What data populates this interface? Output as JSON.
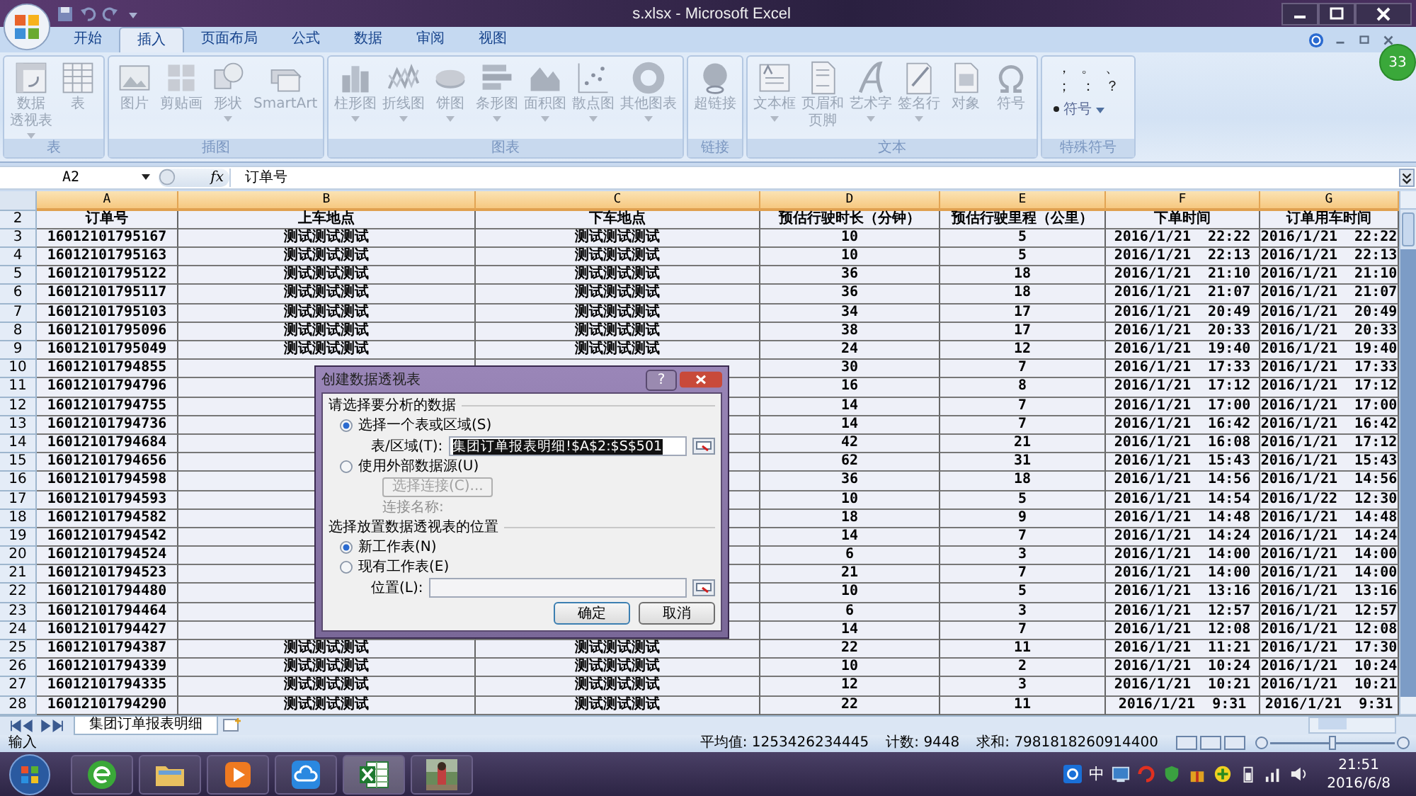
{
  "window": {
    "title": "s.xlsx - Microsoft Excel"
  },
  "ribbon_tabs": [
    {
      "label": "开始",
      "selected": false
    },
    {
      "label": "插入",
      "selected": true
    },
    {
      "label": "页面布局",
      "selected": false
    },
    {
      "label": "公式",
      "selected": false
    },
    {
      "label": "数据",
      "selected": false
    },
    {
      "label": "审阅",
      "selected": false
    },
    {
      "label": "视图",
      "selected": false
    }
  ],
  "badge": "33",
  "ribbon_groups": [
    {
      "label": "表",
      "kind": "buttons",
      "buttons": [
        {
          "lines": [
            "数据",
            "透视表"
          ],
          "dropdown": true
        },
        {
          "label": "表",
          "dropdown": false
        }
      ]
    },
    {
      "label": "插图",
      "kind": "buttons",
      "buttons": [
        {
          "label": "图片",
          "dropdown": false
        },
        {
          "label": "剪贴画",
          "dropdown": false
        },
        {
          "label": "形状",
          "dropdown": true
        },
        {
          "label": "SmartArt",
          "dropdown": false
        }
      ]
    },
    {
      "label": "图表",
      "kind": "buttons",
      "buttons": [
        {
          "label": "柱形图",
          "dropdown": true
        },
        {
          "label": "折线图",
          "dropdown": true
        },
        {
          "label": "饼图",
          "dropdown": true
        },
        {
          "label": "条形图",
          "dropdown": true
        },
        {
          "label": "面积图",
          "dropdown": true
        },
        {
          "label": "散点图",
          "dropdown": true
        },
        {
          "label": "其他图表",
          "dropdown": true
        }
      ]
    },
    {
      "label": "链接",
      "kind": "buttons",
      "buttons": [
        {
          "label": "超链接",
          "dropdown": false
        }
      ]
    },
    {
      "label": "文本",
      "kind": "buttons",
      "buttons": [
        {
          "label": "文本框",
          "dropdown": true
        },
        {
          "lines": [
            "页眉和",
            "页脚"
          ],
          "dropdown": false
        },
        {
          "label": "艺术字",
          "dropdown": true
        },
        {
          "label": "签名行",
          "dropdown": true
        },
        {
          "label": "对象",
          "dropdown": false
        },
        {
          "label": "符号",
          "dropdown": false
        }
      ]
    },
    {
      "label": "特殊符号",
      "kind": "symbols",
      "symbols": [
        "，",
        "。",
        "、",
        "；",
        "：",
        "？"
      ],
      "buttons": [
        {
          "label": "符号",
          "dropdown": true
        }
      ]
    }
  ],
  "formula_bar": {
    "name_box": "A2",
    "function_label": "fx",
    "content": "订单号"
  },
  "sheet": {
    "columns": [
      "A",
      "B",
      "C",
      "D",
      "E",
      "F",
      "G"
    ],
    "header_row": {
      "row": "2",
      "cells": [
        "订单号",
        "上车地点",
        "下车地点",
        "预估行驶时长（分钟）",
        "预估行驶里程（公里）",
        "下单时间",
        "订单用车时间"
      ]
    },
    "rows": [
      {
        "row": "3",
        "kind": "full",
        "cells": [
          "16012101795167",
          "测试测试测试",
          "测试测试测试",
          "10",
          "5",
          "2016/1/21  22:22",
          "2016/1/21  22:22"
        ]
      },
      {
        "row": "4",
        "kind": "full",
        "cells": [
          "16012101795163",
          "测试测试测试",
          "测试测试测试",
          "10",
          "5",
          "2016/1/21  22:13",
          "2016/1/21  22:13"
        ]
      },
      {
        "row": "5",
        "kind": "full",
        "cells": [
          "16012101795122",
          "测试测试测试",
          "测试测试测试",
          "36",
          "18",
          "2016/1/21  21:10",
          "2016/1/21  21:10"
        ]
      },
      {
        "row": "6",
        "kind": "full",
        "cells": [
          "16012101795117",
          "测试测试测试",
          "测试测试测试",
          "36",
          "18",
          "2016/1/21  21:07",
          "2016/1/21  21:07"
        ]
      },
      {
        "row": "7",
        "kind": "full",
        "cells": [
          "16012101795103",
          "测试测试测试",
          "测试测试测试",
          "34",
          "17",
          "2016/1/21  20:49",
          "2016/1/21  20:49"
        ]
      },
      {
        "row": "8",
        "kind": "full",
        "cells": [
          "16012101795096",
          "测试测试测试",
          "测试测试测试",
          "38",
          "17",
          "2016/1/21  20:33",
          "2016/1/21  20:33"
        ]
      },
      {
        "row": "9",
        "kind": "full",
        "cells": [
          "16012101795049",
          "测试测试测试",
          "测试测试测试",
          "24",
          "12",
          "2016/1/21  19:40",
          "2016/1/21  19:40"
        ]
      },
      {
        "row": "10",
        "kind": "covered",
        "cells": [
          "16012101794855",
          "30",
          "7",
          "2016/1/21  17:33",
          "2016/1/21  17:33"
        ]
      },
      {
        "row": "11",
        "kind": "covered",
        "cells": [
          "16012101794796",
          "16",
          "8",
          "2016/1/21  17:12",
          "2016/1/21  17:12"
        ]
      },
      {
        "row": "12",
        "kind": "covered",
        "cells": [
          "16012101794755",
          "14",
          "7",
          "2016/1/21  17:00",
          "2016/1/21  17:00"
        ]
      },
      {
        "row": "13",
        "kind": "covered",
        "cells": [
          "16012101794736",
          "14",
          "7",
          "2016/1/21  16:42",
          "2016/1/21  16:42"
        ]
      },
      {
        "row": "14",
        "kind": "covered",
        "cells": [
          "16012101794684",
          "42",
          "21",
          "2016/1/21  16:08",
          "2016/1/21  17:12"
        ]
      },
      {
        "row": "15",
        "kind": "covered",
        "cells": [
          "16012101794656",
          "62",
          "31",
          "2016/1/21  15:43",
          "2016/1/21  15:43"
        ]
      },
      {
        "row": "16",
        "kind": "covered",
        "cells": [
          "16012101794598",
          "36",
          "18",
          "2016/1/21  14:56",
          "2016/1/21  14:56"
        ]
      },
      {
        "row": "17",
        "kind": "covered",
        "cells": [
          "16012101794593",
          "10",
          "5",
          "2016/1/21  14:54",
          "2016/1/22  12:30"
        ]
      },
      {
        "row": "18",
        "kind": "covered",
        "cells": [
          "16012101794582",
          "18",
          "9",
          "2016/1/21  14:48",
          "2016/1/21  14:48"
        ]
      },
      {
        "row": "19",
        "kind": "covered",
        "cells": [
          "16012101794542",
          "14",
          "7",
          "2016/1/21  14:24",
          "2016/1/21  14:24"
        ]
      },
      {
        "row": "20",
        "kind": "covered",
        "cells": [
          "16012101794524",
          "6",
          "3",
          "2016/1/21  14:00",
          "2016/1/21  14:00"
        ]
      },
      {
        "row": "21",
        "kind": "covered",
        "cells": [
          "16012101794523",
          "21",
          "7",
          "2016/1/21  14:00",
          "2016/1/21  14:00"
        ]
      },
      {
        "row": "22",
        "kind": "covered",
        "cells": [
          "16012101794480",
          "10",
          "5",
          "2016/1/21  13:16",
          "2016/1/21  13:16"
        ]
      },
      {
        "row": "23",
        "kind": "covered",
        "cells": [
          "16012101794464",
          "6",
          "3",
          "2016/1/21  12:57",
          "2016/1/21  12:57"
        ]
      },
      {
        "row": "24",
        "kind": "covered",
        "cells": [
          "16012101794427",
          "14",
          "7",
          "2016/1/21  12:08",
          "2016/1/21  12:08"
        ]
      },
      {
        "row": "25",
        "kind": "full",
        "cells": [
          "16012101794387",
          "测试测试测试",
          "测试测试测试",
          "22",
          "11",
          "2016/1/21  11:21",
          "2016/1/21  17:30"
        ]
      },
      {
        "row": "26",
        "kind": "full",
        "cells": [
          "16012101794339",
          "测试测试测试",
          "测试测试测试",
          "10",
          "2",
          "2016/1/21  10:24",
          "2016/1/21  10:24"
        ]
      },
      {
        "row": "27",
        "kind": "full",
        "cells": [
          "16012101794335",
          "测试测试测试",
          "测试测试测试",
          "12",
          "3",
          "2016/1/21  10:21",
          "2016/1/21  10:21"
        ]
      },
      {
        "row": "28",
        "kind": "full",
        "cells": [
          "16012101794290",
          "测试测试测试",
          "测试测试测试",
          "22",
          "11",
          "2016/1/21  9:31",
          "2016/1/21  9:31"
        ]
      }
    ]
  },
  "dialog": {
    "title": "创建数据透视表",
    "help": "?",
    "source_heading": "请选择要分析的数据",
    "source_options": [
      {
        "label": "选择一个表或区域(S)",
        "selected": true
      },
      {
        "label": "使用外部数据源(U)",
        "selected": false
      }
    ],
    "range_label": "表/区域(T):",
    "range_value": "集团订单报表明细!$A$2:$S$501",
    "connection_button": {
      "label": "选择连接(C)...",
      "disabled": true
    },
    "connection_label": "连接名称:",
    "target_heading": "选择放置数据透视表的位置",
    "target_options": [
      {
        "label": "新工作表(N)",
        "selected": true
      },
      {
        "label": "现有工作表(E)",
        "selected": false
      }
    ],
    "location_label": "位置(L):",
    "buttons": [
      "确定",
      "取消"
    ]
  },
  "sheet_tabs": [
    {
      "label": "集团订单报表明细",
      "selected": true
    }
  ],
  "status_bar": {
    "mode": "输入",
    "average": "平均值: 1253426234445",
    "count": "计数: 9448",
    "sum": "求和: 7981818260914400",
    "zoom_slider": {
      "level": 0.5
    }
  },
  "taskbar": {
    "ime": "中",
    "time": "21:51",
    "date": "2016/6/8"
  }
}
